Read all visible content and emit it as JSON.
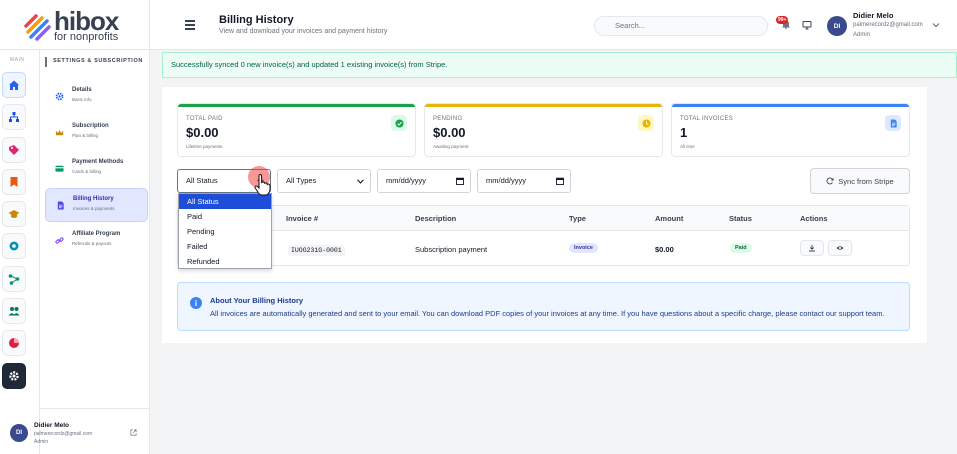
{
  "brand": {
    "name": "hibox",
    "tagline": "for nonprofits"
  },
  "rail": {
    "label": "MAIN",
    "items": [
      {
        "icon": "home-icon",
        "color": "#2563eb",
        "active": true
      },
      {
        "icon": "org-chart-icon",
        "color": "#1d4ed8"
      },
      {
        "icon": "tag-icon",
        "color": "#db2777"
      },
      {
        "icon": "bookmark-icon",
        "color": "#ea580c"
      },
      {
        "icon": "graduation-cap-icon",
        "color": "#ca8a04"
      },
      {
        "icon": "gear-badge-icon",
        "color": "#0891b2"
      },
      {
        "icon": "share-nodes-icon",
        "color": "#059669"
      },
      {
        "icon": "users-icon",
        "color": "#047857"
      },
      {
        "icon": "pie-chart-icon",
        "color": "#e11d48"
      },
      {
        "icon": "settings-icon",
        "color": "#ffffff"
      }
    ]
  },
  "settings_nav": {
    "title": "SETTINGS & SUBSCRIPTION",
    "items": [
      {
        "title": "Details",
        "sub": "Basic info",
        "icon": "gear-icon",
        "active": false
      },
      {
        "title": "Subscription",
        "sub": "Plan & billing",
        "icon": "crown-icon",
        "active": false
      },
      {
        "title": "Payment Methods",
        "sub": "Cards & billing",
        "icon": "card-icon",
        "active": false
      },
      {
        "title": "Billing History",
        "sub": "Invoices & payments",
        "icon": "document-icon",
        "active": true
      },
      {
        "title": "Affiliate Program",
        "sub": "Referrals & payouts",
        "icon": "link-icon",
        "active": false
      }
    ],
    "user": {
      "initials": "DI",
      "name": "Didier Melo",
      "email": "palmerecordz@gmail.com",
      "role": "Admin"
    }
  },
  "header": {
    "title": "Billing History",
    "subtitle": "View and download your invoices and payment history",
    "search_placeholder": "Search...",
    "notification_count": "99+",
    "user": {
      "initials": "DI",
      "name": "Didier Melo",
      "email": "palmerecordz@gmail.com",
      "role": "Admin"
    }
  },
  "alert": {
    "text": "Successfully synced 0 new invoice(s) and updated 1 existing invoice(s) from Stripe."
  },
  "stats": [
    {
      "label": "TOTAL PAID",
      "value": "$0.00",
      "sub": "Lifetime payments",
      "color": "#16a34a"
    },
    {
      "label": "PENDING",
      "value": "$0.00",
      "sub": "Awaiting payment",
      "color": "#eab308"
    },
    {
      "label": "TOTAL INVOICES",
      "value": "1",
      "sub": "All time",
      "color": "#3b82f6"
    }
  ],
  "filters": {
    "status": "All Status",
    "type": "All Types",
    "date_from": "mm/dd/yyyy",
    "date_to": "mm/dd/yyyy",
    "sync_label": "Sync from Stripe",
    "status_options": [
      "All Status",
      "Paid",
      "Pending",
      "Failed",
      "Refunded"
    ]
  },
  "table": {
    "headers": [
      "Invoice #",
      "Description",
      "Type",
      "Amount",
      "Status",
      "Actions"
    ],
    "rows": [
      {
        "invoice": "IUOG231G-0001",
        "description": "Subscription payment",
        "type": "Invoice",
        "amount": "$0.00",
        "status": "Paid"
      }
    ]
  },
  "info": {
    "title": "About Your Billing History",
    "body": "All invoices are automatically generated and sent to your email. You can download PDF copies of your invoices at any time. If you have questions about a specific charge, please contact our support team."
  }
}
